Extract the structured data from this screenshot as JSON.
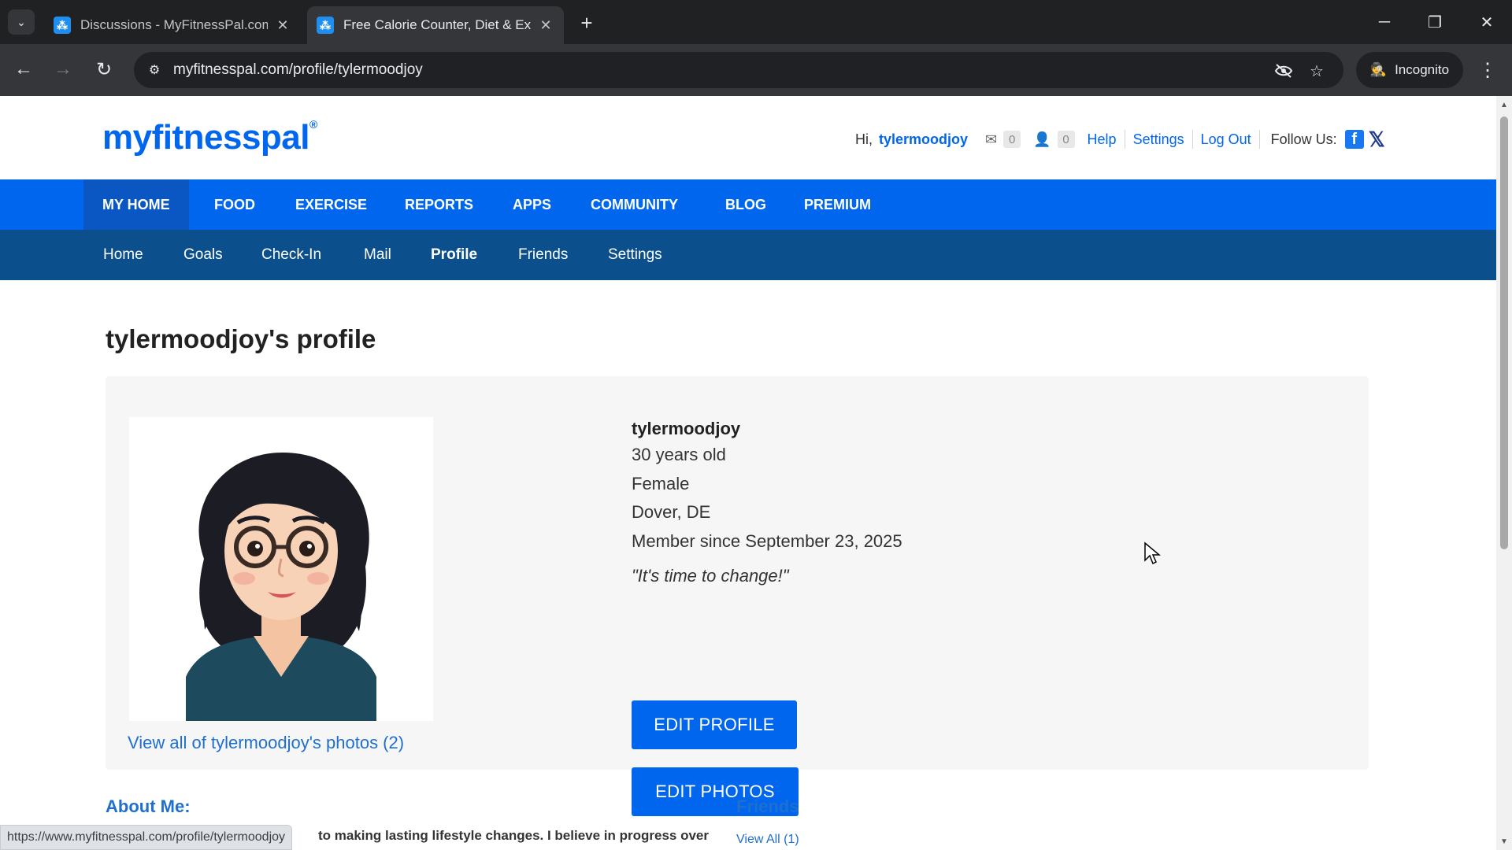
{
  "browser": {
    "tabs": [
      {
        "title": "Discussions - MyFitnessPal.com",
        "active": false
      },
      {
        "title": "Free Calorie Counter, Diet & Ex",
        "active": true
      }
    ],
    "url": "myfitnesspal.com/profile/tylermoodjoy",
    "incognito_label": "Incognito",
    "status_url": "https://www.myfitnesspal.com/profile/tylermoodjoy"
  },
  "site": {
    "logo": "myfitnesspal",
    "brand_color": "#0066ee"
  },
  "userbar": {
    "greeting": "Hi,",
    "username": "tylermoodjoy",
    "mail_count": "0",
    "friend_count": "0",
    "help": "Help",
    "settings": "Settings",
    "logout": "Log Out",
    "follow": "Follow Us:"
  },
  "mainnav": [
    "MY HOME",
    "FOOD",
    "EXERCISE",
    "REPORTS",
    "APPS",
    "COMMUNITY",
    "BLOG",
    "PREMIUM"
  ],
  "subnav": [
    "Home",
    "Goals",
    "Check-In",
    "Mail",
    "Profile",
    "Friends",
    "Settings"
  ],
  "profile": {
    "title": "tylermoodjoy's profile",
    "name": "tylermoodjoy",
    "age": "30 years old",
    "gender": "Female",
    "location": "Dover, DE",
    "member_since": "Member since September 23, 2025",
    "motto": "\"It's time to change!\"",
    "edit_profile": "EDIT PROFILE",
    "edit_photos": "EDIT PHOTOS",
    "photos_link": "View all of tylermoodjoy's photos (2)"
  },
  "about": {
    "title": "About Me:",
    "text": "to making lasting lifestyle changes. I believe in progress over"
  },
  "friends": {
    "title": "Friends",
    "view_all": "View All (1)"
  }
}
